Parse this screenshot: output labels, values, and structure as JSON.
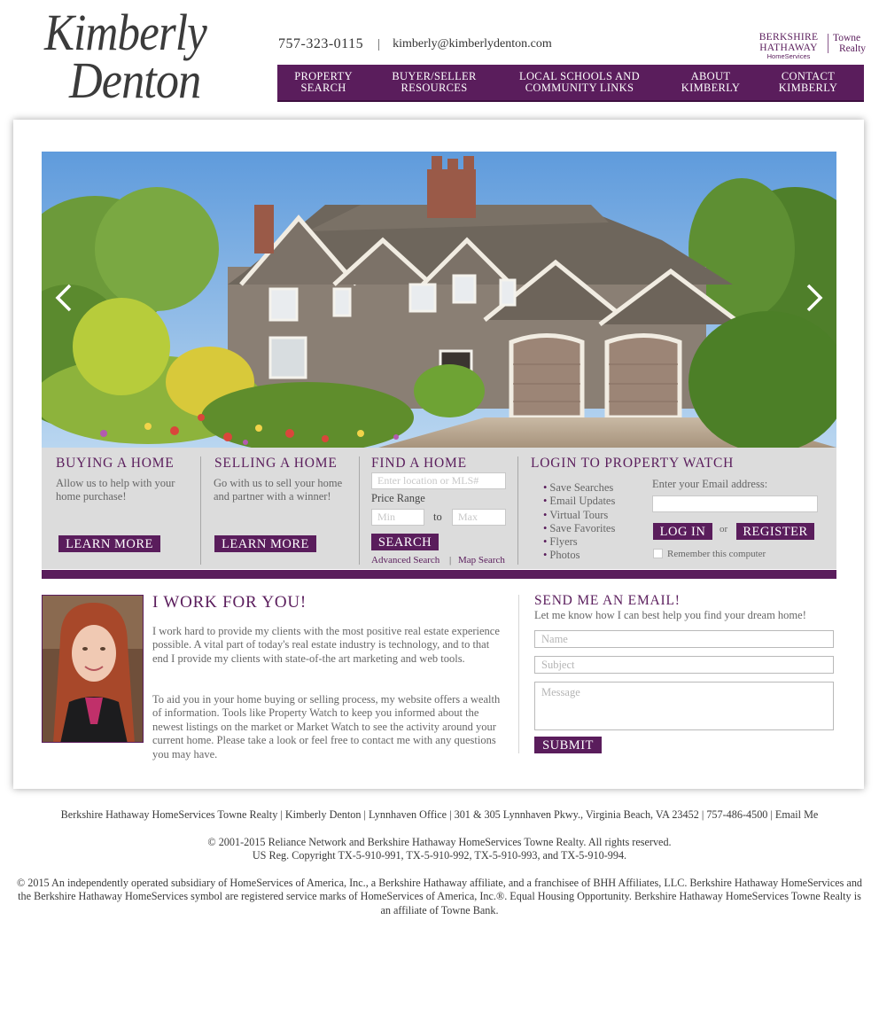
{
  "header": {
    "logo_line1": "Kimberly",
    "logo_line2": "Denton",
    "phone": "757-323-0115",
    "separator": "|",
    "email": "kimberly@kimberlydenton.com",
    "brand": {
      "line1": "BERKSHIRE",
      "line2": "HATHAWAY",
      "sub": "HomeServices",
      "towne1": "Towne",
      "towne2": "Realty"
    }
  },
  "nav": {
    "items": [
      {
        "label": "PROPERTY\nSEARCH"
      },
      {
        "label": "BUYER/SELLER\nRESOURCES"
      },
      {
        "label": "LOCAL  SCHOOLS AND\nCOMMUNITY LINKS"
      },
      {
        "label": "ABOUT\nKIMBERLY"
      },
      {
        "label": "CONTACT\nKIMBERLY"
      }
    ]
  },
  "tools": {
    "buying": {
      "title": "BUYING A HOME",
      "text": "Allow us to help with your home purchase!",
      "button": "LEARN MORE"
    },
    "selling": {
      "title": "SELLING A HOME",
      "text": "Go with us to sell your home and partner with a winner!",
      "button": "LEARN MORE"
    },
    "find": {
      "title": "FIND A HOME",
      "location_placeholder": "Enter location or MLS#",
      "price_label": "Price Range",
      "min_placeholder": "Min",
      "to_label": "to",
      "max_placeholder": "Max",
      "search_button": "SEARCH",
      "advanced_link": "Advanced Search",
      "link_sep": "|",
      "map_link": "Map Search"
    },
    "login": {
      "title": "LOGIN TO PROPERTY WATCH",
      "bullets": [
        "Save Searches",
        "Email Updates",
        "Virtual Tours",
        "Save Favorites",
        "Flyers",
        "Photos"
      ],
      "email_label": "Enter your Email address:",
      "login_button": "LOG IN",
      "or": "or",
      "register_button": "REGISTER",
      "remember": "Remember this computer"
    }
  },
  "bio": {
    "title": "I WORK FOR YOU!",
    "p1": "I work hard to provide my clients with the most positive real estate experience possible. A vital part of today's real estate industry is technology, and to that end I provide my clients with state-of-the art marketing and web tools.",
    "p2": "To aid you in your home buying or selling process, my website offers a wealth of information. Tools like Property Watch to keep you informed about the newest listings on the market or Market Watch to see the activity around your current home. Please take a look or feel free to contact me with any questions you may have."
  },
  "mail": {
    "title": "SEND ME AN EMAIL!",
    "subtitle": "Let me know how I can best help you find your dream home!",
    "name_placeholder": "Name",
    "subject_placeholder": "Subject",
    "message_placeholder": "Message",
    "submit": "SUBMIT"
  },
  "footer": {
    "line1": "Berkshire Hathaway HomeServices Towne Realty | Kimberly Denton | Lynnhaven Office | 301 & 305 Lynnhaven Pkwy., Virginia Beach, VA 23452 | 757-486-4500 | Email Me",
    "line2": "© 2001-2015 Reliance Network and Berkshire Hathaway HomeServices Towne Realty. All rights reserved.",
    "line3": "US Reg. Copyright TX-5-910-991, TX-5-910-992, TX-5-910-993, and TX-5-910-994.",
    "line4": "© 2015 An independently operated subsidiary of HomeServices of America, Inc., a Berkshire Hathaway affiliate, and a franchisee of BHH Affiliates, LLC. Berkshire Hathaway HomeServices and the Berkshire Hathaway HomeServices symbol are registered service marks of HomeServices of America, Inc.®.  Equal Housing Opportunity. Berkshire Hathaway HomeServices Towne Realty is an affiliate of Towne Bank."
  },
  "colors": {
    "brand_purple": "#5a1d5c",
    "panel_gray": "#dcdcdc"
  }
}
